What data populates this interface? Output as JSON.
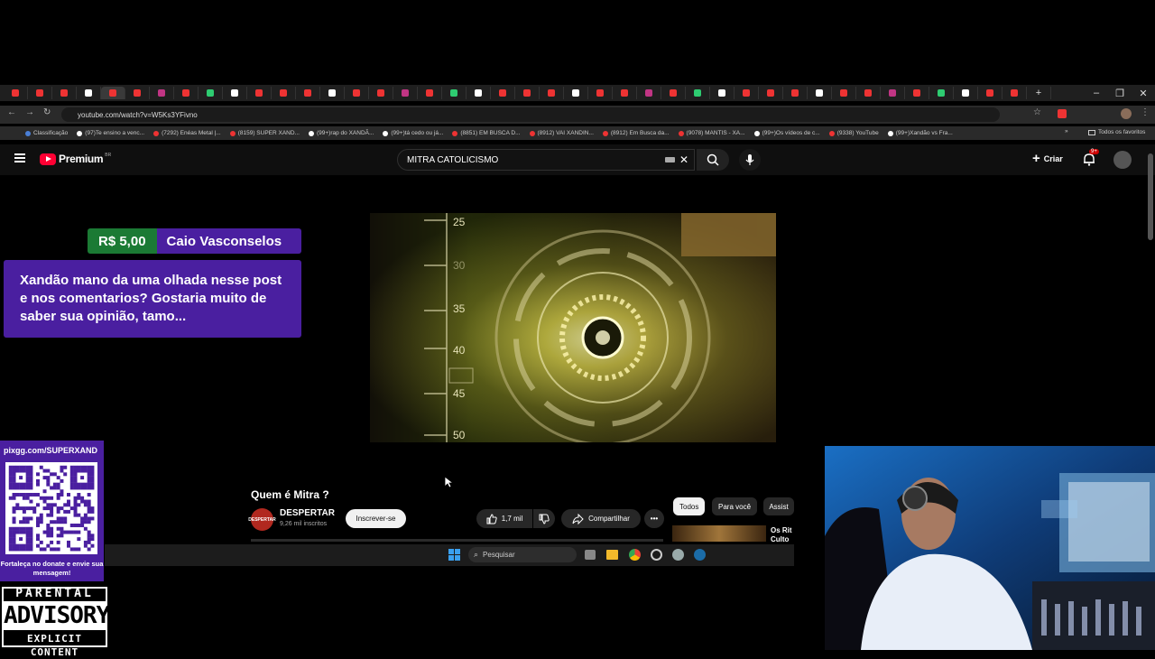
{
  "browser": {
    "url": "youtube.com/watch?v=W5Ks3YFivno",
    "bookmarks": [
      {
        "label": "Classificação",
        "color": "#4a7fd6"
      },
      {
        "label": "(97)Te ensino a venc...",
        "color": "#ffffff"
      },
      {
        "label": "(7292) Enéas Metal |...",
        "color": "#e33"
      },
      {
        "label": "(8159) SUPER XAND...",
        "color": "#e33"
      },
      {
        "label": "(99+)rap do XANDÃ...",
        "color": "#ffffff"
      },
      {
        "label": "(99+)tá cedo ou já...",
        "color": "#ffffff"
      },
      {
        "label": "(8851) EM BUSCA D...",
        "color": "#e33"
      },
      {
        "label": "(8912) VAI XANDIN...",
        "color": "#e33"
      },
      {
        "label": "(8912) Em Busca da...",
        "color": "#e33"
      },
      {
        "label": "(9078) MANTIS - XA...",
        "color": "#e33"
      },
      {
        "label": "(99+)Os vídeos de c...",
        "color": "#ffffff"
      },
      {
        "label": "(9338) YouTube",
        "color": "#e33"
      },
      {
        "label": "(99+)Xandão vs Fra...",
        "color": "#ffffff"
      }
    ],
    "bookmarks_folder": "Todos os favoritos",
    "tab_count": 42
  },
  "youtube": {
    "logo": "Premium",
    "logo_region": "BR",
    "search_value": "MITRA CATOLICISMO",
    "create_label": "Criar",
    "notif_badge": "9+"
  },
  "donation": {
    "amount": "R$ 5,00",
    "name": "Caio Vasconselos",
    "message": "Xandão mano da uma olhada nesse post e nos comentarios? Gostaria muito de saber sua opinião, tamo..."
  },
  "video": {
    "overlay_ticks": [
      "25",
      "30",
      "35",
      "40",
      "45",
      "50"
    ],
    "title": "Quem é Mitra ?",
    "channel": "DESPERTAR",
    "subscribers": "9,26 mil inscritos",
    "avatar_text": "DESPERTAR",
    "subscribe_label": "Inscrever-se",
    "likes": "1,7 mil",
    "share_label": "Compartilhar",
    "chips": [
      "Todos",
      "Para você",
      "Assist"
    ],
    "side_item_title": "Os Rit Culto"
  },
  "taskbar": {
    "search_placeholder": "Pesquisar"
  },
  "overlay": {
    "pix_url": "pixgg.com/SUPERXAND",
    "cta": "Fortaleça no donate e envie sua mensagem!",
    "advisory_top": "PARENTAL",
    "advisory_mid": "ADVISORY",
    "advisory_bottom": "EXPLICIT CONTENT"
  },
  "colors": {
    "donation_green": "#1b7a34",
    "donation_purple": "#4a1fa0",
    "yt_red": "#ff0033"
  }
}
